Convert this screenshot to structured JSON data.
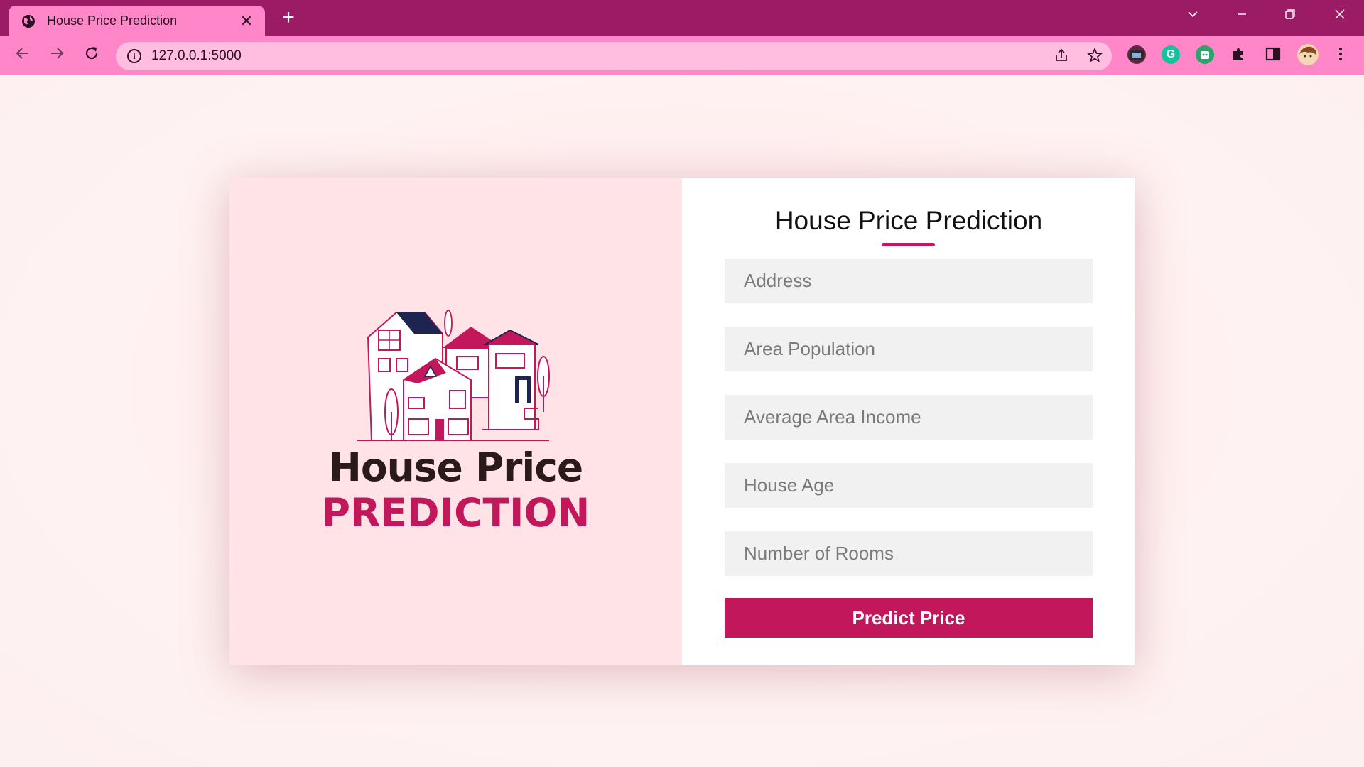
{
  "browser": {
    "tab_title": "House Price Prediction",
    "tab_close": "✕",
    "new_tab": "+",
    "url": "127.0.0.1:5000",
    "accent_color": "#9b1b65",
    "toolbar_color": "#ff86c8"
  },
  "brand": {
    "line1": "House Price",
    "line2": "PREDICTION",
    "line2_color": "#c2185b"
  },
  "form": {
    "title": "House Price Prediction",
    "fields": [
      {
        "placeholder": "Address",
        "value": ""
      },
      {
        "placeholder": "Area Population",
        "value": ""
      },
      {
        "placeholder": "Average Area Income",
        "value": ""
      },
      {
        "placeholder": "House Age",
        "value": ""
      },
      {
        "placeholder": "Number of Rooms",
        "value": ""
      }
    ],
    "submit_label": "Predict Price",
    "submit_color": "#c2185b"
  }
}
